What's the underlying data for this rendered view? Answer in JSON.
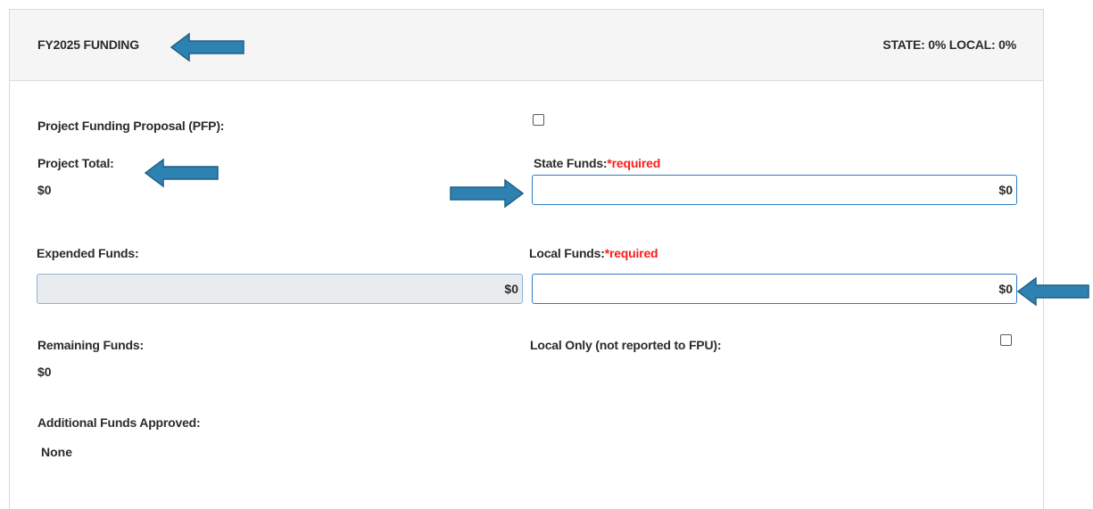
{
  "header": {
    "title": "FY2025 FUNDING",
    "percentages": "STATE: 0% LOCAL: 0%"
  },
  "fields": {
    "pfp": {
      "label": "Project Funding Proposal (PFP):",
      "checked": false
    },
    "project_total": {
      "label": "Project Total:",
      "value": "$0"
    },
    "state_funds": {
      "label": "State Funds:",
      "required": "*required",
      "value": "$0"
    },
    "expended_funds": {
      "label": "Expended Funds:",
      "value": "$0"
    },
    "local_funds": {
      "label": "Local Funds:",
      "required": "*required",
      "value": "$0"
    },
    "remaining_funds": {
      "label": "Remaining Funds:",
      "value": "$0"
    },
    "local_only": {
      "label": "Local Only (not reported to FPU):",
      "checked": false
    },
    "additional_funds": {
      "label": "Additional Funds Approved:",
      "value": "None"
    }
  },
  "colors": {
    "arrow": "#2e82b2",
    "required": "#ff1a1a",
    "input_border": "#2f7cc4",
    "header_bg": "#f5f5f5",
    "disabled_bg": "#e9ecef"
  }
}
